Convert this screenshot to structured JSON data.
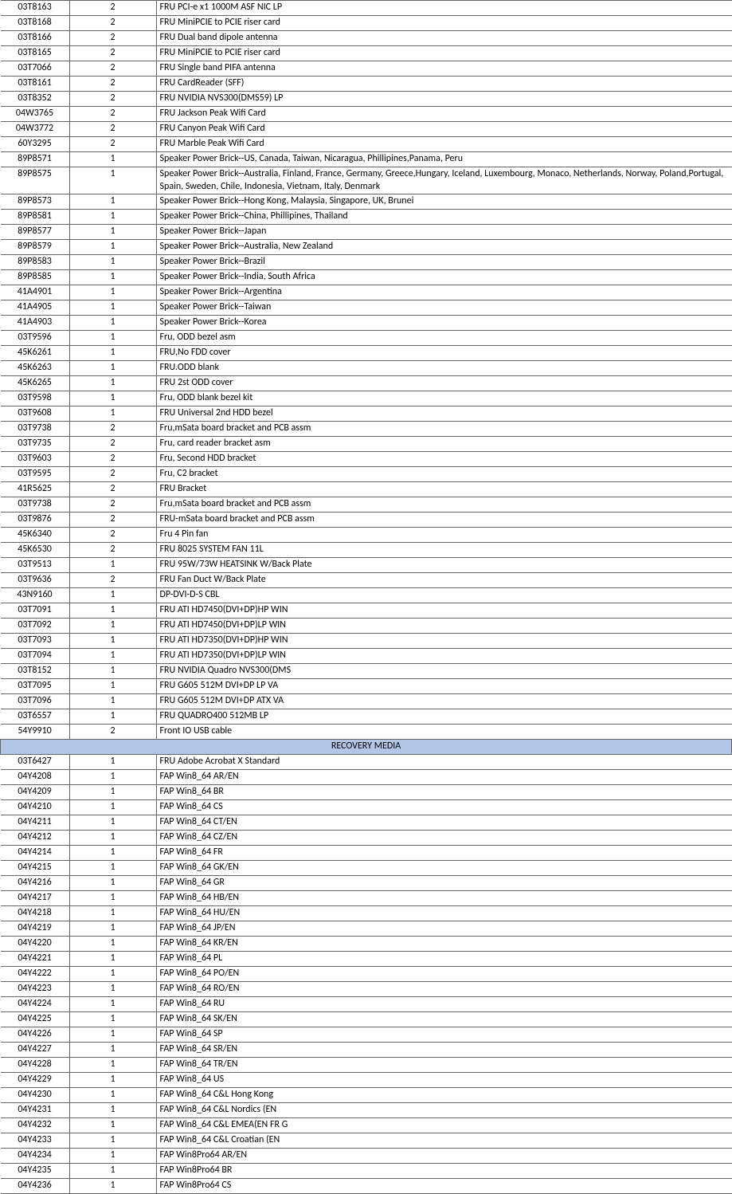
{
  "rows": [
    {
      "part": "03T8163",
      "qty": "2",
      "desc": "FRU PCI-e x1 1000M ASF NIC  LP"
    },
    {
      "part": "03T8168",
      "qty": "2",
      "desc": "FRU MiniPCIE  to PCIE riser  card"
    },
    {
      "part": "03T8166",
      "qty": "2",
      "desc": "FRU Dual band dipole  antenna"
    },
    {
      "part": "03T8165",
      "qty": "2",
      "desc": "FRU MiniPCIE to PCIE riser card"
    },
    {
      "part": "03T7066",
      "qty": "2",
      "desc": "FRU Single band  PIFA antenna"
    },
    {
      "part": "03T8161",
      "qty": "2",
      "desc": "FRU CardReader  (SFF)"
    },
    {
      "part": "03T8352",
      "qty": "2",
      "desc": "FRU NVIDIA NVS300(DMS59) LP"
    },
    {
      "part": "04W3765",
      "qty": "2",
      "desc": "FRU Jackson Peak Wifi Card"
    },
    {
      "part": "04W3772",
      "qty": "2",
      "desc": "FRU Canyon Peak Wifi Card"
    },
    {
      "part": "60Y3295",
      "qty": "2",
      "desc": "FRU Marble Peak Wifi Card"
    },
    {
      "part": "89P8571",
      "qty": "1",
      "desc": "Speaker Power Brick--US, Canada, Taiwan, Nicaragua, Phillipines,Panama, Peru"
    },
    {
      "part": "89P8575",
      "qty": "1",
      "desc": "Speaker Power Brick--Australia, Finland, France, Germany,  Greece,Hungary, Iceland, Luxembourg, Monaco, Netherlands,  Norway, Poland,Portugal, Spain, Sweden, Chile,  Indonesia, Vietnam, Italy, Denmark"
    },
    {
      "part": "89P8573",
      "qty": "1",
      "desc": "Speaker Power Brick--Hong Kong, Malaysia, Singapore, UK, Brunei"
    },
    {
      "part": "89P8581",
      "qty": "1",
      "desc": "Speaker Power Brick--China,  Phillipines, Thailand"
    },
    {
      "part": "89P8577",
      "qty": "1",
      "desc": "Speaker Power Brick--Japan"
    },
    {
      "part": "89P8579",
      "qty": "1",
      "desc": "Speaker Power Brick--Australia, New Zealand"
    },
    {
      "part": "89P8583",
      "qty": "1",
      "desc": "Speaker Power Brick--Brazil"
    },
    {
      "part": "89P8585",
      "qty": "1",
      "desc": "Speaker Power Brick--India,  South Africa"
    },
    {
      "part": "41A4901",
      "qty": "1",
      "desc": "Speaker Power Brick--Argentina"
    },
    {
      "part": "41A4905",
      "qty": "1",
      "desc": "Speaker Power Brick--Taiwan"
    },
    {
      "part": "41A4903",
      "qty": "1",
      "desc": "Speaker Power Brick--Korea"
    },
    {
      "part": "03T9596",
      "qty": "1",
      "desc": "Fru, ODD bezel asm"
    },
    {
      "part": "45K6261",
      "qty": "1",
      "desc": "FRU,No FDD cover"
    },
    {
      "part": "45K6263",
      "qty": "1",
      "desc": "FRU.ODD blank"
    },
    {
      "part": "45K6265",
      "qty": "1",
      "desc": "FRU 2st ODD cover"
    },
    {
      "part": "03T9598",
      "qty": "1",
      "desc": "Fru, ODD blank bezel kit"
    },
    {
      "part": "03T9608",
      "qty": "1",
      "desc": "FRU Universal  2nd HDD   bezel"
    },
    {
      "part": "03T9738",
      "qty": "2",
      "desc": "Fru,mSata board bracket and PCB assm"
    },
    {
      "part": "03T9735",
      "qty": "2",
      "desc": "Fru, card reader bracket asm"
    },
    {
      "part": "03T9603",
      "qty": "2",
      "desc": "Fru, Second HDD bracket"
    },
    {
      "part": "03T9595",
      "qty": "2",
      "desc": "Fru, C2 bracket"
    },
    {
      "part": "41R5625",
      "qty": "2",
      "desc": "FRU Bracket"
    },
    {
      "part": "03T9738",
      "qty": "2",
      "desc": "Fru,mSata board bracket and PCB assm"
    },
    {
      "part": "03T9876",
      "qty": "2",
      "desc": "FRU-mSata board bracket and PCB assm"
    },
    {
      "part": "45K6340",
      "qty": "2",
      "desc": "Fru 4 Pin fan"
    },
    {
      "part": "45K6530",
      "qty": "2",
      "desc": "FRU 8025 SYSTEM  FAN 11L"
    },
    {
      "part": "03T9513",
      "qty": "1",
      "desc": "FRU 95W/73W HEATSINK W/Back  Plate"
    },
    {
      "part": "03T9636",
      "qty": "2",
      "desc": "FRU Fan Duct  W/Back Plate"
    },
    {
      "part": "43N9160",
      "qty": "1",
      "desc": "DP-DVI-D-S CBL"
    },
    {
      "part": "03T7091",
      "qty": "1",
      "desc": "FRU ATI HD7450(DVI+DP)HP WIN"
    },
    {
      "part": "03T7092",
      "qty": "1",
      "desc": "FRU ATI HD7450(DVI+DP)LP  WIN"
    },
    {
      "part": "03T7093",
      "qty": "1",
      "desc": "FRU ATI HD7350(DVI+DP)HP WIN"
    },
    {
      "part": "03T7094",
      "qty": "1",
      "desc": "FRU ATI HD7350(DVI+DP)LP  WIN"
    },
    {
      "part": "03T8152",
      "qty": "1",
      "desc": "FRU NVIDIA Quadro NVS300(DMS"
    },
    {
      "part": "03T7095",
      "qty": "1",
      "desc": "FRU G605  512M DVI+DP  LP VA"
    },
    {
      "part": "03T7096",
      "qty": "1",
      "desc": "FRU G605  512M DVI+DP  ATX VA"
    },
    {
      "part": "03T6557",
      "qty": "1",
      "desc": "FRU QUADRO400  512MB LP"
    },
    {
      "part": "54Y9910",
      "qty": "2",
      "desc": "Front IO USB cable"
    },
    {
      "section": "RECOVERY MEDIA"
    },
    {
      "part": "03T6427",
      "qty": "1",
      "desc": "FRU Adobe Acrobat X   Standard"
    },
    {
      "part": "04Y4208",
      "qty": "1",
      "desc": "FAP Win8_64 AR/EN"
    },
    {
      "part": "04Y4209",
      "qty": "1",
      "desc": "FAP Win8_64 BR"
    },
    {
      "part": "04Y4210",
      "qty": "1",
      "desc": "FAP Win8_64 CS"
    },
    {
      "part": "04Y4211",
      "qty": "1",
      "desc": "FAP Win8_64 CT/EN"
    },
    {
      "part": "04Y4212",
      "qty": "1",
      "desc": "FAP Win8_64 CZ/EN"
    },
    {
      "part": "04Y4214",
      "qty": "1",
      "desc": "FAP Win8_64 FR"
    },
    {
      "part": "04Y4215",
      "qty": "1",
      "desc": "FAP Win8_64 GK/EN"
    },
    {
      "part": "04Y4216",
      "qty": "1",
      "desc": "FAP Win8_64 GR"
    },
    {
      "part": "04Y4217",
      "qty": "1",
      "desc": "FAP Win8_64 HB/EN"
    },
    {
      "part": "04Y4218",
      "qty": "1",
      "desc": "FAP Win8_64 HU/EN"
    },
    {
      "part": "04Y4219",
      "qty": "1",
      "desc": "FAP Win8_64 JP/EN"
    },
    {
      "part": "04Y4220",
      "qty": "1",
      "desc": "FAP Win8_64 KR/EN"
    },
    {
      "part": "04Y4221",
      "qty": "1",
      "desc": "FAP Win8_64 PL"
    },
    {
      "part": "04Y4222",
      "qty": "1",
      "desc": "FAP Win8_64 PO/EN"
    },
    {
      "part": "04Y4223",
      "qty": "1",
      "desc": "FAP Win8_64 RO/EN"
    },
    {
      "part": "04Y4224",
      "qty": "1",
      "desc": "FAP Win8_64 RU"
    },
    {
      "part": "04Y4225",
      "qty": "1",
      "desc": "FAP Win8_64 SK/EN"
    },
    {
      "part": "04Y4226",
      "qty": "1",
      "desc": "FAP Win8_64 SP"
    },
    {
      "part": "04Y4227",
      "qty": "1",
      "desc": "FAP Win8_64 SR/EN"
    },
    {
      "part": "04Y4228",
      "qty": "1",
      "desc": "FAP Win8_64 TR/EN"
    },
    {
      "part": "04Y4229",
      "qty": "1",
      "desc": "FAP Win8_64 US"
    },
    {
      "part": "04Y4230",
      "qty": "1",
      "desc": "FAP Win8_64 C&L Hong Kong"
    },
    {
      "part": "04Y4231",
      "qty": "1",
      "desc": "FAP Win8_64 C&L Nordics (EN"
    },
    {
      "part": "04Y4232",
      "qty": "1",
      "desc": "FAP Win8_64 C&L EMEA(EN FR G"
    },
    {
      "part": "04Y4233",
      "qty": "1",
      "desc": "FAP Win8_64 C&L Croatian (EN"
    },
    {
      "part": "04Y4234",
      "qty": "1",
      "desc": "FAP Win8Pro64 AR/EN"
    },
    {
      "part": "04Y4235",
      "qty": "1",
      "desc": "FAP Win8Pro64 BR"
    },
    {
      "part": "04Y4236",
      "qty": "1",
      "desc": "FAP Win8Pro64 CS"
    }
  ]
}
